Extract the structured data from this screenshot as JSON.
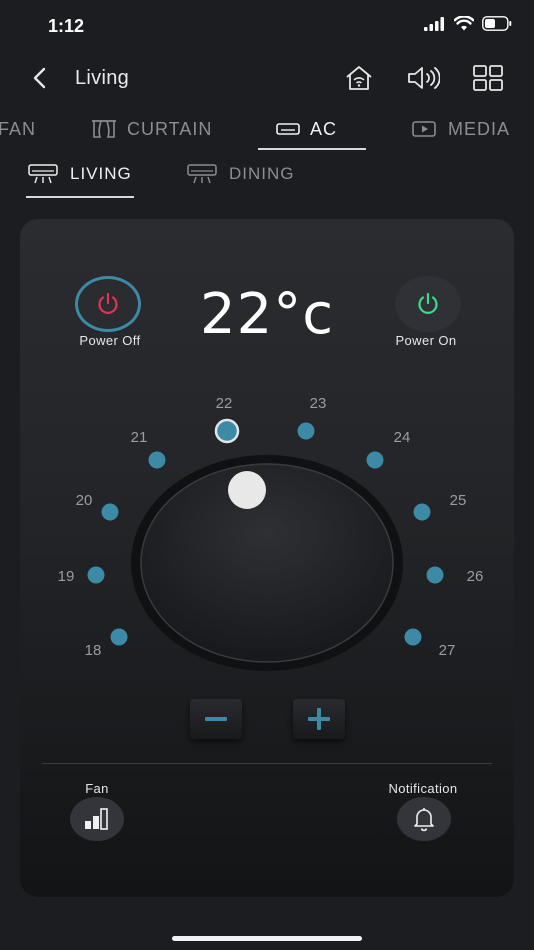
{
  "status_bar": {
    "time": "1:12"
  },
  "nav": {
    "back_icon": "chevron-left-icon",
    "title": "Living"
  },
  "tabs": [
    {
      "label": "FAN",
      "icon": "fan-icon",
      "active": false
    },
    {
      "label": "CURTAIN",
      "icon": "curtain-icon",
      "active": false
    },
    {
      "label": "AC",
      "icon": "ac-icon",
      "active": true
    },
    {
      "label": "MEDIA",
      "icon": "media-icon",
      "active": false
    }
  ],
  "subtabs": [
    {
      "label": "LIVING",
      "icon": "ac-unit-icon",
      "active": true
    },
    {
      "label": "DINING",
      "icon": "ac-unit-icon",
      "active": false
    }
  ],
  "controls": {
    "power_off_label": "Power Off",
    "power_on_label": "Power On",
    "temperature": "22°c",
    "selected_temp": 22,
    "temps": [
      "18",
      "19",
      "20",
      "21",
      "22",
      "23",
      "24",
      "25",
      "26",
      "27"
    ],
    "minus_icon": "minus-icon",
    "plus_icon": "plus-icon",
    "fan_label": "Fan",
    "notification_label": "Notification"
  },
  "colors": {
    "accent_blue": "#3d8aa6",
    "power_off_red": "#e0345a",
    "power_on_green": "#3fd98a"
  }
}
